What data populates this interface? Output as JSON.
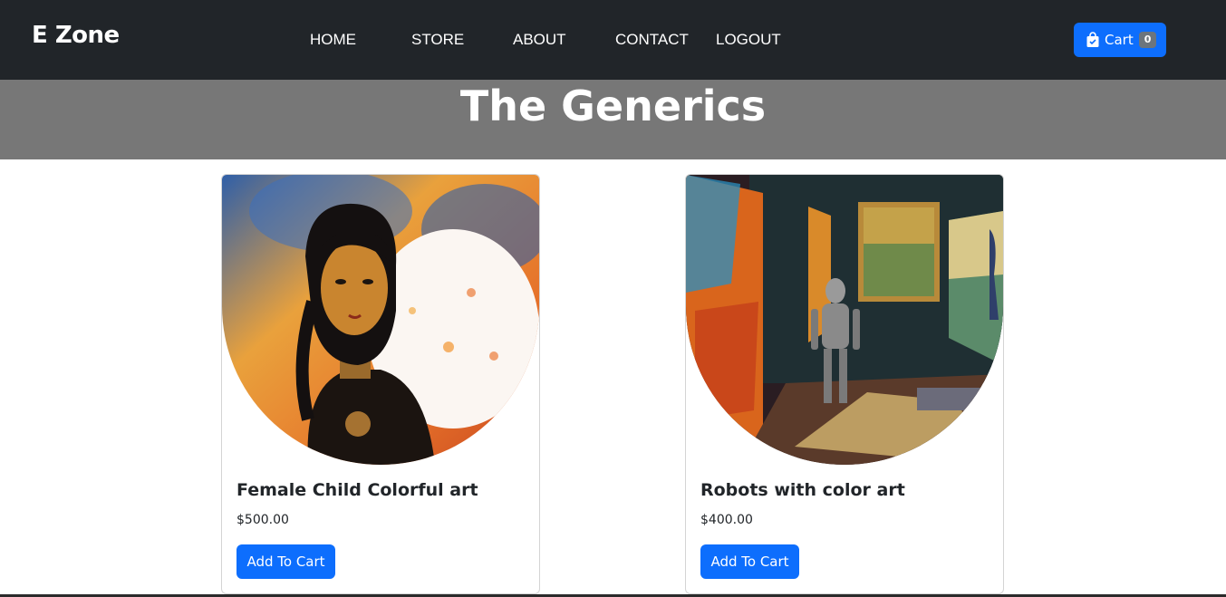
{
  "navbar": {
    "brand": "E Zone",
    "links": [
      "HOME",
      "STORE",
      "ABOUT",
      "CONTACT",
      "LOGOUT"
    ],
    "cart": {
      "label": "Cart",
      "count": "0",
      "icon": "shopping-bag-icon"
    }
  },
  "hero": {
    "title": "The Generics"
  },
  "products": [
    {
      "title": "Female Child Colorful art",
      "price": "$500.00",
      "button": "Add To Cart"
    },
    {
      "title": "Robots with color art",
      "price": "$400.00",
      "button": "Add To Cart"
    }
  ],
  "colors": {
    "nav_bg": "#212529",
    "hero_bg": "#777777",
    "primary": "#0d6efd",
    "badge": "#6c757d"
  }
}
